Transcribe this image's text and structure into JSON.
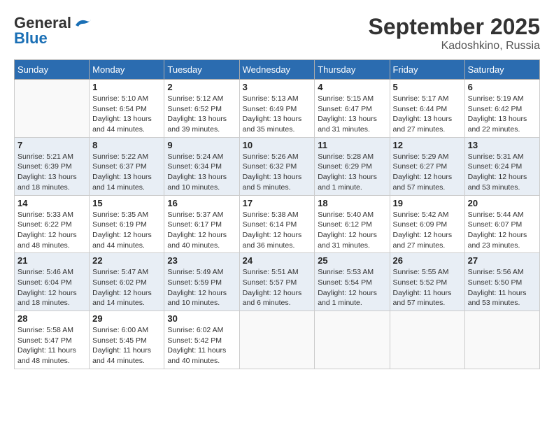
{
  "header": {
    "logo_line1": "General",
    "logo_line2": "Blue",
    "month": "September 2025",
    "location": "Kadoshkino, Russia"
  },
  "weekdays": [
    "Sunday",
    "Monday",
    "Tuesday",
    "Wednesday",
    "Thursday",
    "Friday",
    "Saturday"
  ],
  "weeks": [
    [
      {
        "day": "",
        "info": ""
      },
      {
        "day": "1",
        "info": "Sunrise: 5:10 AM\nSunset: 6:54 PM\nDaylight: 13 hours\nand 44 minutes."
      },
      {
        "day": "2",
        "info": "Sunrise: 5:12 AM\nSunset: 6:52 PM\nDaylight: 13 hours\nand 39 minutes."
      },
      {
        "day": "3",
        "info": "Sunrise: 5:13 AM\nSunset: 6:49 PM\nDaylight: 13 hours\nand 35 minutes."
      },
      {
        "day": "4",
        "info": "Sunrise: 5:15 AM\nSunset: 6:47 PM\nDaylight: 13 hours\nand 31 minutes."
      },
      {
        "day": "5",
        "info": "Sunrise: 5:17 AM\nSunset: 6:44 PM\nDaylight: 13 hours\nand 27 minutes."
      },
      {
        "day": "6",
        "info": "Sunrise: 5:19 AM\nSunset: 6:42 PM\nDaylight: 13 hours\nand 22 minutes."
      }
    ],
    [
      {
        "day": "7",
        "info": "Sunrise: 5:21 AM\nSunset: 6:39 PM\nDaylight: 13 hours\nand 18 minutes."
      },
      {
        "day": "8",
        "info": "Sunrise: 5:22 AM\nSunset: 6:37 PM\nDaylight: 13 hours\nand 14 minutes."
      },
      {
        "day": "9",
        "info": "Sunrise: 5:24 AM\nSunset: 6:34 PM\nDaylight: 13 hours\nand 10 minutes."
      },
      {
        "day": "10",
        "info": "Sunrise: 5:26 AM\nSunset: 6:32 PM\nDaylight: 13 hours\nand 5 minutes."
      },
      {
        "day": "11",
        "info": "Sunrise: 5:28 AM\nSunset: 6:29 PM\nDaylight: 13 hours\nand 1 minute."
      },
      {
        "day": "12",
        "info": "Sunrise: 5:29 AM\nSunset: 6:27 PM\nDaylight: 12 hours\nand 57 minutes."
      },
      {
        "day": "13",
        "info": "Sunrise: 5:31 AM\nSunset: 6:24 PM\nDaylight: 12 hours\nand 53 minutes."
      }
    ],
    [
      {
        "day": "14",
        "info": "Sunrise: 5:33 AM\nSunset: 6:22 PM\nDaylight: 12 hours\nand 48 minutes."
      },
      {
        "day": "15",
        "info": "Sunrise: 5:35 AM\nSunset: 6:19 PM\nDaylight: 12 hours\nand 44 minutes."
      },
      {
        "day": "16",
        "info": "Sunrise: 5:37 AM\nSunset: 6:17 PM\nDaylight: 12 hours\nand 40 minutes."
      },
      {
        "day": "17",
        "info": "Sunrise: 5:38 AM\nSunset: 6:14 PM\nDaylight: 12 hours\nand 36 minutes."
      },
      {
        "day": "18",
        "info": "Sunrise: 5:40 AM\nSunset: 6:12 PM\nDaylight: 12 hours\nand 31 minutes."
      },
      {
        "day": "19",
        "info": "Sunrise: 5:42 AM\nSunset: 6:09 PM\nDaylight: 12 hours\nand 27 minutes."
      },
      {
        "day": "20",
        "info": "Sunrise: 5:44 AM\nSunset: 6:07 PM\nDaylight: 12 hours\nand 23 minutes."
      }
    ],
    [
      {
        "day": "21",
        "info": "Sunrise: 5:46 AM\nSunset: 6:04 PM\nDaylight: 12 hours\nand 18 minutes."
      },
      {
        "day": "22",
        "info": "Sunrise: 5:47 AM\nSunset: 6:02 PM\nDaylight: 12 hours\nand 14 minutes."
      },
      {
        "day": "23",
        "info": "Sunrise: 5:49 AM\nSunset: 5:59 PM\nDaylight: 12 hours\nand 10 minutes."
      },
      {
        "day": "24",
        "info": "Sunrise: 5:51 AM\nSunset: 5:57 PM\nDaylight: 12 hours\nand 6 minutes."
      },
      {
        "day": "25",
        "info": "Sunrise: 5:53 AM\nSunset: 5:54 PM\nDaylight: 12 hours\nand 1 minute."
      },
      {
        "day": "26",
        "info": "Sunrise: 5:55 AM\nSunset: 5:52 PM\nDaylight: 11 hours\nand 57 minutes."
      },
      {
        "day": "27",
        "info": "Sunrise: 5:56 AM\nSunset: 5:50 PM\nDaylight: 11 hours\nand 53 minutes."
      }
    ],
    [
      {
        "day": "28",
        "info": "Sunrise: 5:58 AM\nSunset: 5:47 PM\nDaylight: 11 hours\nand 48 minutes."
      },
      {
        "day": "29",
        "info": "Sunrise: 6:00 AM\nSunset: 5:45 PM\nDaylight: 11 hours\nand 44 minutes."
      },
      {
        "day": "30",
        "info": "Sunrise: 6:02 AM\nSunset: 5:42 PM\nDaylight: 11 hours\nand 40 minutes."
      },
      {
        "day": "",
        "info": ""
      },
      {
        "day": "",
        "info": ""
      },
      {
        "day": "",
        "info": ""
      },
      {
        "day": "",
        "info": ""
      }
    ]
  ]
}
